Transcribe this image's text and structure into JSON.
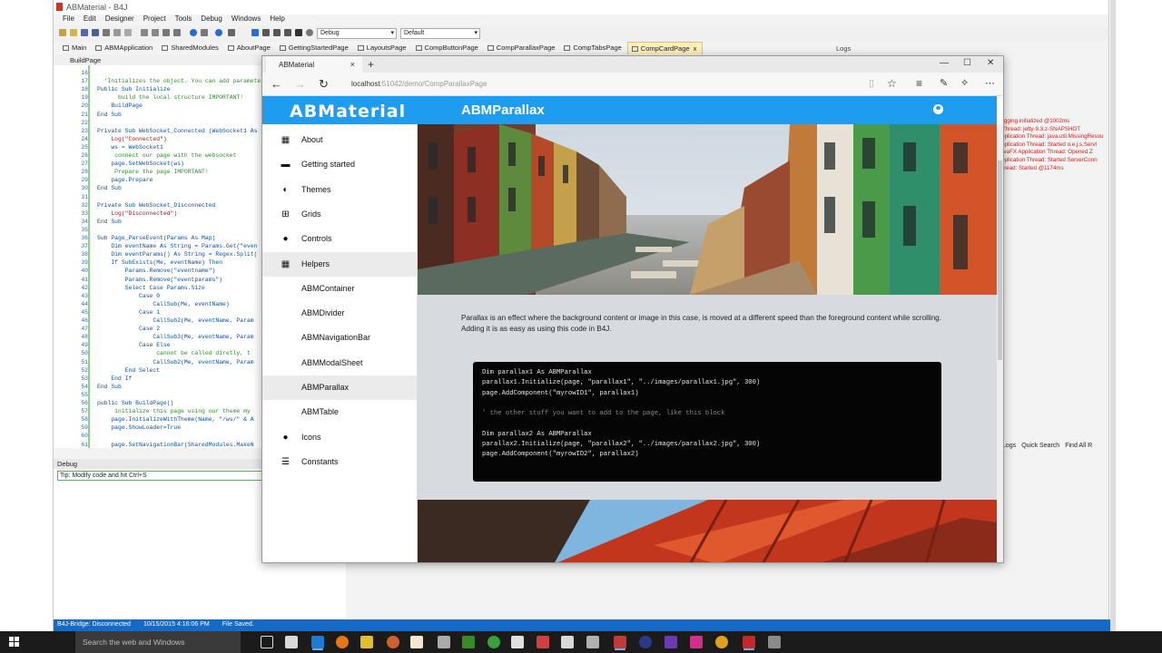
{
  "ide": {
    "title": "ABMaterial - B4J",
    "menu": [
      "File",
      "Edit",
      "Designer",
      "Project",
      "Tools",
      "Debug",
      "Windows",
      "Help"
    ],
    "config_select": "Debug",
    "target_select": "Default",
    "tabs": [
      "Main",
      "ABMApplication",
      "SharedModules",
      "AboutPage",
      "GettingStartedPage",
      "LayoutsPage",
      "CompButtonPage",
      "CompParallaxPage",
      "CompTabsPage",
      "CompCardPage"
    ],
    "active_tab_close": "x",
    "logs_tab": "Logs",
    "module_dropdown": "BuildPage",
    "code_lines": [
      {
        "n": "16",
        "t": "",
        "k": "n"
      },
      {
        "n": "17",
        "t": "  'Initializes the object. You can add parameters",
        "k": "c"
      },
      {
        "n": "18",
        "t": "Public Sub Initialize",
        "k": "n"
      },
      {
        "n": "19",
        "t": "      build the local structure IMPORTANT!",
        "k": "c"
      },
      {
        "n": "20",
        "t": "    BuildPage",
        "k": "n"
      },
      {
        "n": "21",
        "t": "End Sub",
        "k": "n"
      },
      {
        "n": "22",
        "t": "",
        "k": "n"
      },
      {
        "n": "23",
        "t": "Private Sub WebSocket_Connected (WebSocket1 As",
        "k": "n"
      },
      {
        "n": "24",
        "t": "    Log(\"Connected\")",
        "k": "s"
      },
      {
        "n": "25",
        "t": "    ws = WebSocket1",
        "k": "n"
      },
      {
        "n": "26",
        "t": "     connect our page with the websocket",
        "k": "c"
      },
      {
        "n": "27",
        "t": "    page.SetWebSocket(ws)",
        "k": "n"
      },
      {
        "n": "28",
        "t": "     Prepare the page IMPORTANT!",
        "k": "c"
      },
      {
        "n": "29",
        "t": "    page.Prepare",
        "k": "n"
      },
      {
        "n": "30",
        "t": "End Sub",
        "k": "n"
      },
      {
        "n": "31",
        "t": "",
        "k": "n"
      },
      {
        "n": "32",
        "t": "Private Sub WebSocket_Disconnected",
        "k": "n"
      },
      {
        "n": "33",
        "t": "    Log(\"Disconnected\")",
        "k": "s"
      },
      {
        "n": "34",
        "t": "End Sub",
        "k": "n"
      },
      {
        "n": "35",
        "t": "",
        "k": "n"
      },
      {
        "n": "36",
        "t": "Sub Page_ParseEvent(Params As Map)",
        "k": "n"
      },
      {
        "n": "37",
        "t": "    Dim eventName As String = Params.Get(\"even",
        "k": "n"
      },
      {
        "n": "38",
        "t": "    Dim eventParams() As String = Regex.Split(",
        "k": "n"
      },
      {
        "n": "39",
        "t": "    If SubExists(Me, eventName) Then",
        "k": "n"
      },
      {
        "n": "40",
        "t": "        Params.Remove(\"eventname\")",
        "k": "n"
      },
      {
        "n": "41",
        "t": "        Params.Remove(\"eventparams\")",
        "k": "n"
      },
      {
        "n": "42",
        "t": "        Select Case Params.Size",
        "k": "n"
      },
      {
        "n": "43",
        "t": "            Case 0",
        "k": "n"
      },
      {
        "n": "44",
        "t": "                CallSub(Me, eventName)",
        "k": "n"
      },
      {
        "n": "45",
        "t": "            Case 1",
        "k": "n"
      },
      {
        "n": "46",
        "t": "                CallSub2(Me, eventName, Param",
        "k": "n"
      },
      {
        "n": "47",
        "t": "            Case 2",
        "k": "n"
      },
      {
        "n": "48",
        "t": "                CallSub3(Me, eventName, Param",
        "k": "n"
      },
      {
        "n": "49",
        "t": "            Case Else",
        "k": "n"
      },
      {
        "n": "50",
        "t": "                 cannot be called diretly, t",
        "k": "c"
      },
      {
        "n": "51",
        "t": "                CallSub2(Me, eventName, Param",
        "k": "n"
      },
      {
        "n": "52",
        "t": "        End Select",
        "k": "n"
      },
      {
        "n": "53",
        "t": "    End If",
        "k": "n"
      },
      {
        "n": "54",
        "t": "End Sub",
        "k": "n"
      },
      {
        "n": "55",
        "t": "",
        "k": "n"
      },
      {
        "n": "56",
        "t": "public Sub BuildPage()",
        "k": "n"
      },
      {
        "n": "57",
        "t": "     initialize this page using our theme my",
        "k": "c"
      },
      {
        "n": "58",
        "t": "    page.InitializeWithTheme(Name, \"/ws/\" & A",
        "k": "n"
      },
      {
        "n": "59",
        "t": "    page.ShowLoader=True",
        "k": "n"
      },
      {
        "n": "60",
        "t": "",
        "k": "n"
      },
      {
        "n": "61",
        "t": "    page.SetNavigationBar(SharedModules.MakeN",
        "k": "n"
      }
    ],
    "logs": [
      "Logging initialized @1002ms",
      "n Thread: jetty-9.3.z-SNAPSHOT",
      "Application Thread: java.util.MissingResou",
      "Application Thread: Started o.e.j.s.Servl",
      "JavaFX Application Thread: Opened Z",
      "Application Thread: Started ServerConn",
      "Thread: Started @1174ms"
    ],
    "logs_strip": [
      "Logs",
      "Quick Search",
      "Find All R"
    ],
    "debug_label": "Debug",
    "debug_tip": "Tip: Modify code and hit Ctrl+S",
    "status": [
      "B4J-Bridge: Disconnected",
      "10/15/2015 4:16:06 PM",
      "File Saved."
    ]
  },
  "browser": {
    "tab_title": "ABMaterial",
    "tab_close": "×",
    "new_tab": "+",
    "url_host": "localhost",
    "url_rest": ":51042/demo/CompParallaxPage",
    "window_controls": [
      "—",
      "☐",
      "✕"
    ]
  },
  "app": {
    "logo": "ABMaterial",
    "page_title": "ABMParallax",
    "nav": [
      {
        "label": "About",
        "icon": "grid-icon"
      },
      {
        "label": "Getting started",
        "icon": "message-icon"
      },
      {
        "label": "Themes",
        "icon": "contrast-icon"
      },
      {
        "label": "Grids",
        "icon": "table-icon"
      },
      {
        "label": "Controls",
        "icon": "palette-icon"
      },
      {
        "label": "Helpers",
        "icon": "apps-icon"
      },
      {
        "label": "ABMContainer",
        "icon": ""
      },
      {
        "label": "ABMDivider",
        "icon": ""
      },
      {
        "label": "ABMNavigationBar",
        "icon": ""
      },
      {
        "label": "ABMModalSheet",
        "icon": ""
      },
      {
        "label": "ABMParallax",
        "icon": ""
      },
      {
        "label": "ABMTable",
        "icon": ""
      },
      {
        "label": "Icons",
        "icon": "person-icon"
      },
      {
        "label": "Constants",
        "icon": "list-icon"
      }
    ],
    "description": "Parallax is an effect where the background content or image in this case, is moved at a different speed than the foreground content while scrolling. Adding it is as easy as using this code in B4J.",
    "code": [
      {
        "t": "Dim parallax1 As ABMParallax",
        "k": "n"
      },
      {
        "t": "parallax1.Initialize(page, \"parallax1\", \"../images/parallax1.jpg\", 300)",
        "k": "n"
      },
      {
        "t": "page.AddComponent(\"myrowID1\", parallax1)",
        "k": "n"
      },
      {
        "t": "",
        "k": "n"
      },
      {
        "t": "' the other stuff you want to add to the page, like this block",
        "k": "c"
      },
      {
        "t": "",
        "k": "n"
      },
      {
        "t": "Dim parallax2 As ABMParallax",
        "k": "n"
      },
      {
        "t": "parallax2.Initialize(page, \"parallax2\", \"../images/parallax2.jpg\", 300)",
        "k": "n"
      },
      {
        "t": "page.AddComponent(\"myrowID2\", parallax2)",
        "k": "n"
      }
    ]
  },
  "taskbar": {
    "search_placeholder": "Search the web and Windows"
  }
}
